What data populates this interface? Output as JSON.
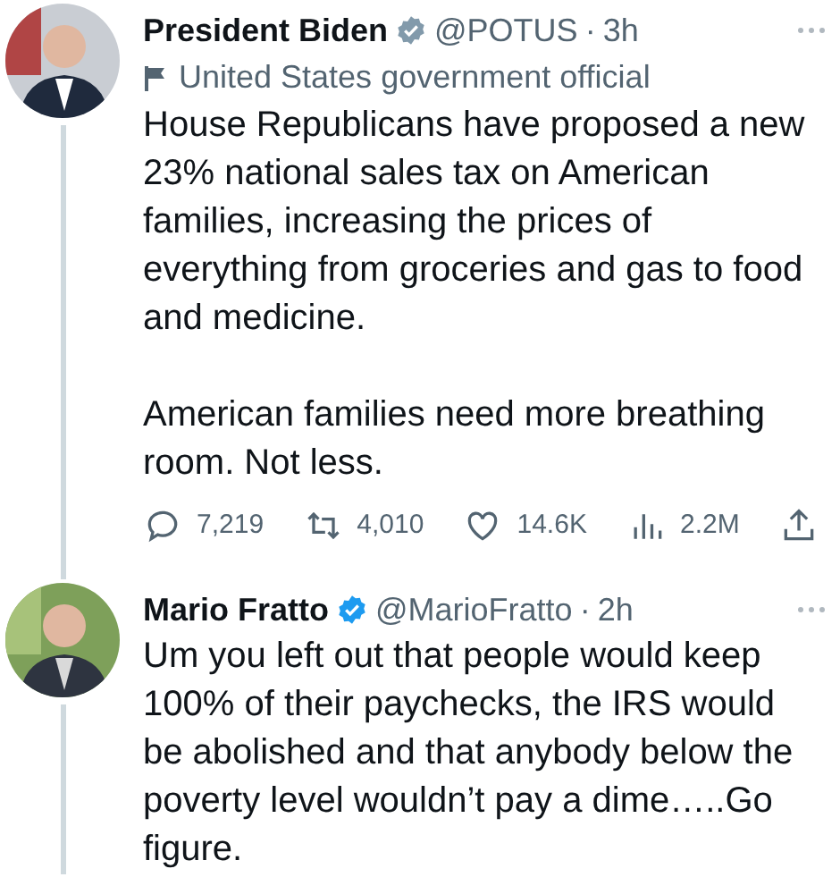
{
  "tweets": [
    {
      "name": "President Biden",
      "badge": {
        "kind": "government"
      },
      "handle": "@POTUS",
      "dot": "·",
      "time": "3h",
      "label": "United States government official",
      "paragraphs": [
        "House Republicans have proposed a new 23% national sales tax on American families, increasing the prices of everything from groceries and gas to food and medicine.",
        "American families need more breathing room. Not less."
      ],
      "actions": [
        {
          "kind": "reply",
          "count": "7,219"
        },
        {
          "kind": "retweet",
          "count": "4,010"
        },
        {
          "kind": "like",
          "count": "14.6K"
        },
        {
          "kind": "views",
          "count": "2.2M"
        },
        {
          "kind": "share"
        }
      ]
    },
    {
      "name": "Mario Fratto",
      "badge": {
        "kind": "verified"
      },
      "handle": "@MarioFratto",
      "dot": "·",
      "time": "2h",
      "paragraphs": [
        "Um you left out that people would keep 100% of their paychecks, the IRS would be abolished and that anybody below the poverty level wouldn’t pay a dime…..Go figure."
      ]
    }
  ]
}
